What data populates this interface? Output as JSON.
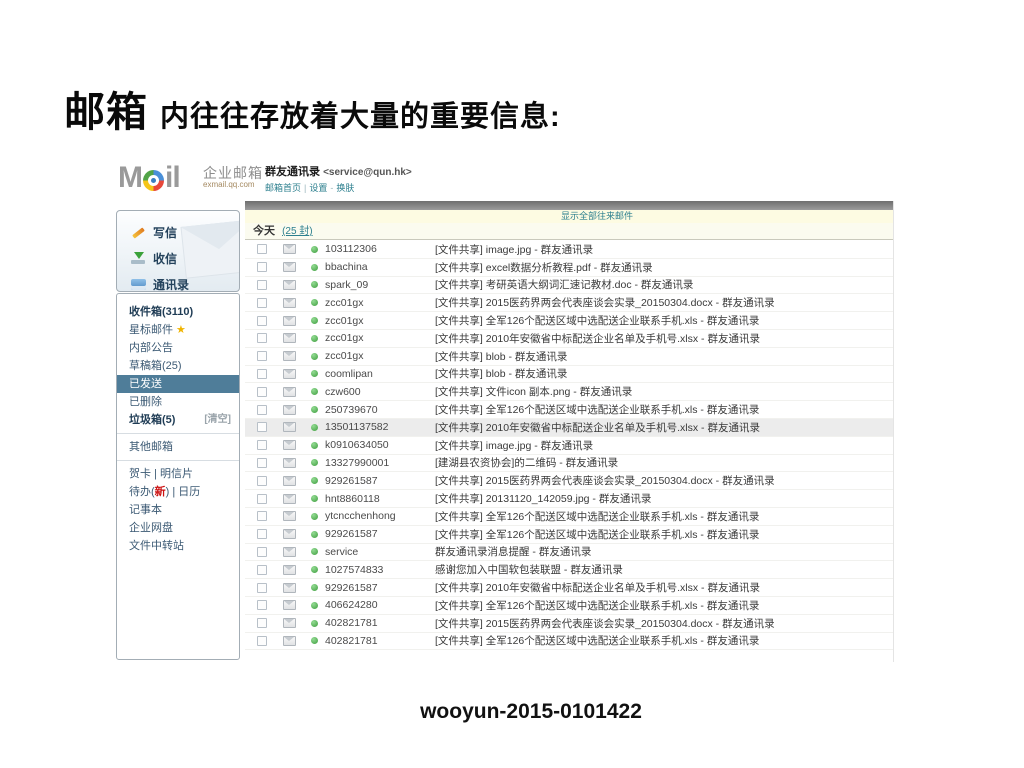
{
  "slide": {
    "title_emphasis": "邮箱",
    "title_rest": "内往往存放着大量的重要信息:",
    "footer": "wooyun-2015-0101422"
  },
  "colors": {
    "accent_teal": "#2c7f8e",
    "selected_folder_bg": "#4f7d99",
    "star_gold": "#f0b400",
    "highlight_row": "#ececec",
    "banner_bg": "#fdfbe2"
  },
  "mail": {
    "logo": {
      "m": "M",
      "il": "il",
      "brand": "企业邮箱",
      "brand_domain": "exmail.qq.com"
    },
    "account": {
      "name": "群友通讯录",
      "address": "<service@qun.hk>",
      "links": [
        "邮箱首页",
        "设置",
        "换肤"
      ],
      "sep1": "|",
      "sep2": "-"
    },
    "icons": {
      "star": "★"
    },
    "nav_top": [
      {
        "label": "写信",
        "icon": "ic-pencil",
        "icon_name": "compose-icon"
      },
      {
        "label": "收信",
        "icon": "ic-tray",
        "icon_name": "receive-icon"
      },
      {
        "label": "通讯录",
        "icon": "ic-card",
        "icon_name": "contacts-icon"
      }
    ],
    "folders": [
      {
        "label": "收件箱(3110)",
        "bold": true
      },
      {
        "label": "星标邮件",
        "star": true
      },
      {
        "label": "内部公告"
      },
      {
        "label": "草稿箱(25)"
      },
      {
        "label": "已发送",
        "selected": true
      },
      {
        "label": "已删除"
      },
      {
        "label": "垃圾箱(5)",
        "bold": true,
        "action": "[清空]"
      },
      {
        "divider": true
      },
      {
        "label": "其他邮箱"
      },
      {
        "divider": true
      },
      {
        "label": "贺卡 | 明信片"
      },
      {
        "parts": [
          {
            "text": "待办("
          },
          {
            "text": "新",
            "accent": true
          },
          {
            "text": ") | 日历"
          }
        ]
      },
      {
        "label": "记事本"
      },
      {
        "label": "企业网盘"
      },
      {
        "label": "文件中转站"
      }
    ],
    "list": {
      "banner_link": "显示全部往来邮件",
      "group_label": "今天",
      "group_count": "(25 封)",
      "rows": [
        {
          "sender": "103112306",
          "subject": "[文件共享] image.jpg - 群友通讯录"
        },
        {
          "sender": "bbachina",
          "subject": "[文件共享] excel数据分析教程.pdf - 群友通讯录"
        },
        {
          "sender": "spark_09",
          "subject": "[文件共享] 考研英语大纲词汇速记教材.doc - 群友通讯录"
        },
        {
          "sender": "zcc01gx",
          "subject": "[文件共享] 2015医药界两会代表座谈会实录_20150304.docx - 群友通讯录"
        },
        {
          "sender": "zcc01gx",
          "subject": "[文件共享] 全军126个配送区域中选配送企业联系手机.xls - 群友通讯录"
        },
        {
          "sender": "zcc01gx",
          "subject": "[文件共享] 2010年安徽省中标配送企业名单及手机号.xlsx - 群友通讯录"
        },
        {
          "sender": "zcc01gx",
          "subject": "[文件共享] blob - 群友通讯录"
        },
        {
          "sender": "coomlipan",
          "subject": "[文件共享] blob - 群友通讯录"
        },
        {
          "sender": "czw600",
          "subject": "[文件共享] 文件icon 副本.png - 群友通讯录"
        },
        {
          "sender": "250739670",
          "subject": "[文件共享] 全军126个配送区域中选配送企业联系手机.xls - 群友通讯录"
        },
        {
          "sender": "13501137582",
          "subject": "[文件共享] 2010年安徽省中标配送企业名单及手机号.xlsx - 群友通讯录",
          "selected": true
        },
        {
          "sender": "k0910634050",
          "subject": "[文件共享] image.jpg - 群友通讯录"
        },
        {
          "sender": "13327990001",
          "subject": "[建湖县农资协会]的二维码 - 群友通讯录"
        },
        {
          "sender": "929261587",
          "subject": "[文件共享] 2015医药界两会代表座谈会实录_20150304.docx - 群友通讯录"
        },
        {
          "sender": "hnt8860118",
          "subject": "[文件共享] 20131120_142059.jpg - 群友通讯录"
        },
        {
          "sender": "ytcncchenhong",
          "subject": "[文件共享] 全军126个配送区域中选配送企业联系手机.xls - 群友通讯录"
        },
        {
          "sender": "929261587",
          "subject": "[文件共享] 全军126个配送区域中选配送企业联系手机.xls - 群友通讯录"
        },
        {
          "sender": "service",
          "subject": "群友通讯录消息提醒 - 群友通讯录"
        },
        {
          "sender": "1027574833",
          "subject": "感谢您加入中国软包装联盟 - 群友通讯录"
        },
        {
          "sender": "929261587",
          "subject": "[文件共享] 2010年安徽省中标配送企业名单及手机号.xlsx - 群友通讯录"
        },
        {
          "sender": "406624280",
          "subject": "[文件共享] 全军126个配送区域中选配送企业联系手机.xls - 群友通讯录"
        },
        {
          "sender": "402821781",
          "subject": "[文件共享] 2015医药界两会代表座谈会实录_20150304.docx - 群友通讯录"
        },
        {
          "sender": "402821781",
          "subject": "[文件共享] 全军126个配送区域中选配送企业联系手机.xls - 群友通讯录"
        }
      ]
    }
  }
}
